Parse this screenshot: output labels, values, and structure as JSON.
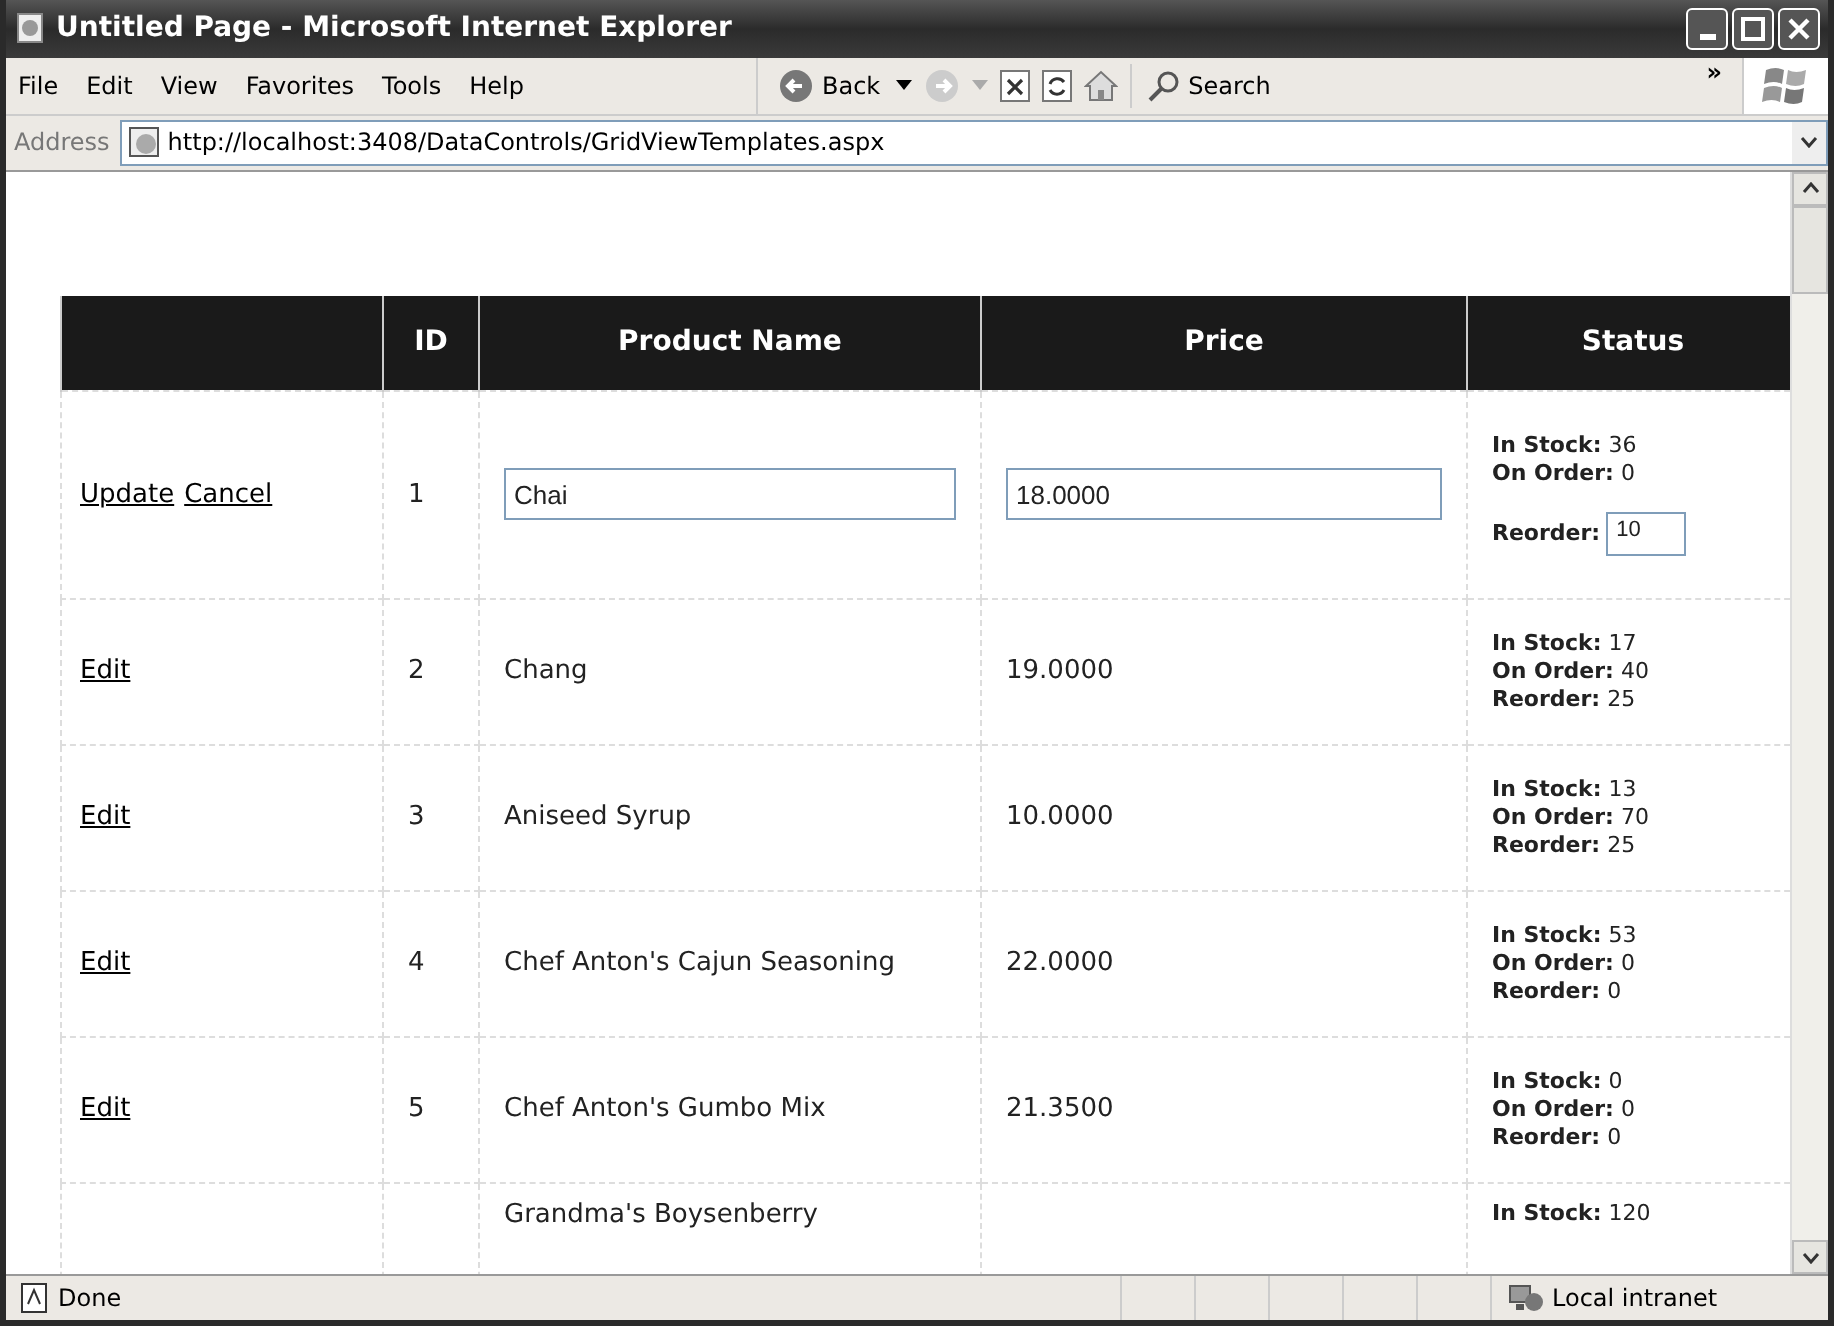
{
  "window": {
    "title": "Untitled Page - Microsoft Internet Explorer"
  },
  "menu_bar": {
    "items": [
      "File",
      "Edit",
      "View",
      "Favorites",
      "Tools",
      "Help"
    ]
  },
  "toolbar": {
    "back": "Back",
    "search": "Search",
    "more": "»"
  },
  "address_bar": {
    "label": "Address",
    "url": "http://localhost:3408/DataControls/GridViewTemplates.aspx"
  },
  "table": {
    "columns": [
      "",
      "ID",
      "Product Name",
      "Price",
      "Status"
    ],
    "rows": [
      {
        "kind": "editing",
        "actions": [
          "Update",
          "Cancel"
        ],
        "id": "1",
        "product_name": "Chai",
        "price": "18.0000",
        "status": [
          {
            "kind": "text",
            "label": "In Stock:",
            "value": "36"
          },
          {
            "kind": "text",
            "label": "On Order:",
            "value": "0"
          },
          {
            "kind": "input",
            "label": "Reorder:",
            "value": "10"
          }
        ]
      },
      {
        "kind": "view",
        "actions": [
          "Edit"
        ],
        "id": "2",
        "product_name": "Chang",
        "price": "19.0000",
        "status": [
          {
            "kind": "text",
            "label": "In Stock:",
            "value": "17"
          },
          {
            "kind": "text",
            "label": "On Order:",
            "value": "40"
          },
          {
            "kind": "text",
            "label": "Reorder:",
            "value": "25"
          }
        ]
      },
      {
        "kind": "view",
        "actions": [
          "Edit"
        ],
        "id": "3",
        "product_name": "Aniseed Syrup",
        "price": "10.0000",
        "status": [
          {
            "kind": "text",
            "label": "In Stock:",
            "value": "13"
          },
          {
            "kind": "text",
            "label": "On Order:",
            "value": "70"
          },
          {
            "kind": "text",
            "label": "Reorder:",
            "value": "25"
          }
        ]
      },
      {
        "kind": "view",
        "actions": [
          "Edit"
        ],
        "id": "4",
        "product_name": "Chef Anton's Cajun Seasoning",
        "price": "22.0000",
        "status": [
          {
            "kind": "text",
            "label": "In Stock:",
            "value": "53"
          },
          {
            "kind": "text",
            "label": "On Order:",
            "value": "0"
          },
          {
            "kind": "text",
            "label": "Reorder:",
            "value": "0"
          }
        ]
      },
      {
        "kind": "view",
        "actions": [
          "Edit"
        ],
        "id": "5",
        "product_name": "Chef Anton's Gumbo Mix",
        "price": "21.3500",
        "status": [
          {
            "kind": "text",
            "label": "In Stock:",
            "value": "0"
          },
          {
            "kind": "text",
            "label": "On Order:",
            "value": "0"
          },
          {
            "kind": "text",
            "label": "Reorder:",
            "value": "0"
          }
        ]
      },
      {
        "kind": "view",
        "actions": [],
        "product_name": "Grandma's Boysenberry",
        "status": [
          {
            "kind": "text",
            "label": "In Stock:",
            "value": "120"
          }
        ]
      }
    ]
  },
  "status_bar": {
    "text": "Done",
    "zone": "Local intranet"
  }
}
